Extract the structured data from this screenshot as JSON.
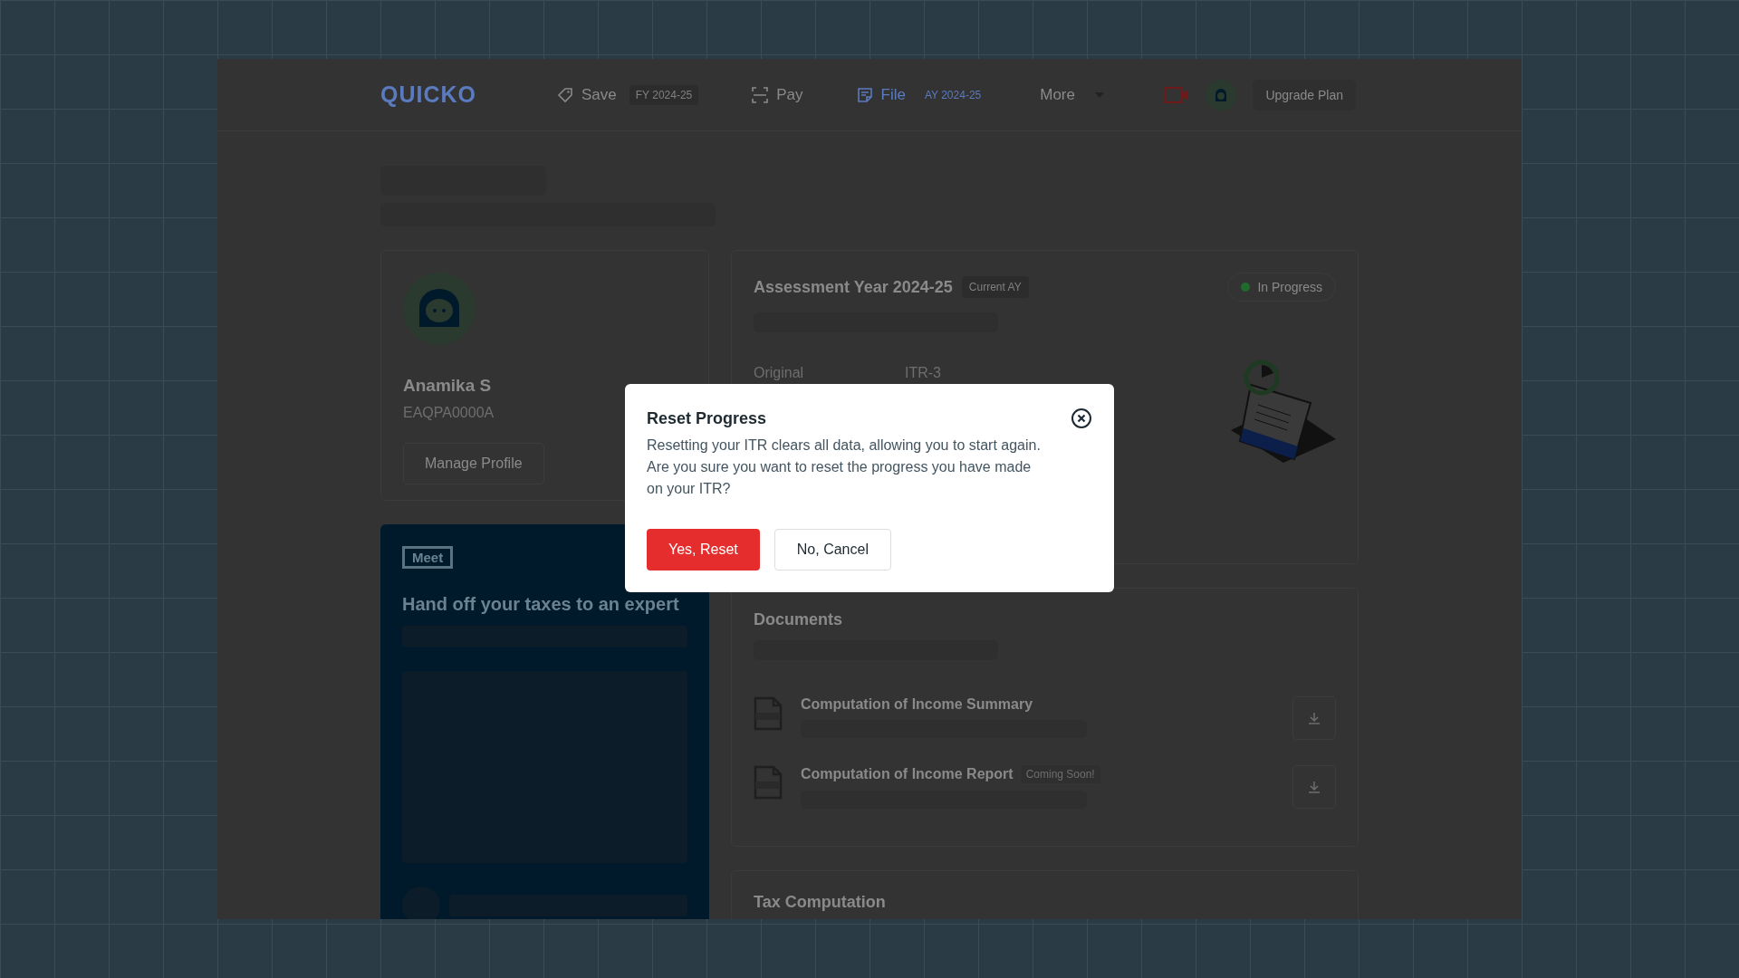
{
  "header": {
    "logo": "QUICKO",
    "nav": [
      {
        "kind": "link",
        "label": "Save",
        "tag": "FY 2024-25",
        "selected": false
      },
      {
        "kind": "link",
        "label": "Pay",
        "selected": false
      },
      {
        "kind": "link",
        "label": "File",
        "tag": "AY 2024-25",
        "selected": true
      },
      {
        "kind": "dropdown",
        "label": "More",
        "selected": false
      }
    ],
    "upgrade": "Upgrade Plan"
  },
  "profile": {
    "name": "Anamika S",
    "pan": "EAQPA0000A",
    "button": "Manage Profile"
  },
  "meet": {
    "logo": "Meet",
    "title": "Hand off your taxes to an expert"
  },
  "assessment": {
    "title": "Assessment Year 2024-25",
    "badge": "Current AY",
    "status": {
      "label": "In Progress",
      "color": "#1f6b2e"
    },
    "rows": [
      {
        "label": "Original",
        "value": "ITR-3"
      }
    ]
  },
  "documents": {
    "title": "Documents",
    "items": [
      {
        "name": "Computation of Income Summary"
      },
      {
        "name": "Computation of Income Report",
        "badge": "Coming Soon!"
      }
    ]
  },
  "tax": {
    "title": "Tax Computation"
  },
  "modal": {
    "title": "Reset Progress",
    "body": "Resetting your ITR clears all data, allowing you to start again. Are you sure you want to reset the progress you have made on your ITR?",
    "buttons": [
      {
        "kind": "primary",
        "label": "Yes, Reset"
      },
      {
        "kind": "secondary",
        "label": "No, Cancel"
      }
    ]
  }
}
